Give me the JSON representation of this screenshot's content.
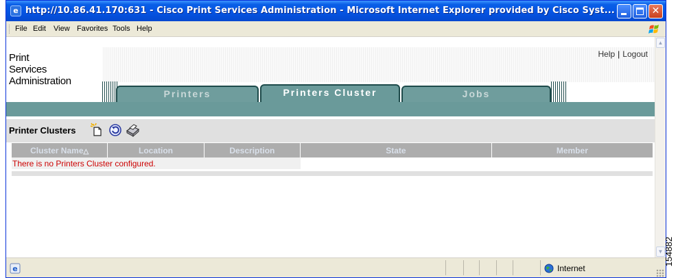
{
  "window": {
    "title": "http://10.86.41.170:631 - Cisco Print Services Administration - Microsoft Internet Explorer provided by Cisco Syst...",
    "minimize_label": "",
    "close_glyph": "✕"
  },
  "menu": [
    "File",
    "Edit",
    "View",
    "Favorites",
    "Tools",
    "Help"
  ],
  "app": {
    "title_lines": [
      "Print",
      "Services",
      "Administration"
    ],
    "links": {
      "help": "Help",
      "separator": "|",
      "logout": "Logout"
    },
    "tabs": [
      {
        "label": "Printers",
        "active": false
      },
      {
        "label": "Printers Cluster",
        "active": true
      },
      {
        "label": "Jobs",
        "active": false
      }
    ]
  },
  "section": {
    "title": "Printer Clusters",
    "icons": [
      "new-cluster-icon",
      "refresh-icon",
      "printer-icon"
    ]
  },
  "table": {
    "columns": [
      "Cluster Name",
      "Location",
      "Description",
      "State",
      "Member"
    ],
    "sort_indicator": "△",
    "empty_message": "There is no Printers Cluster configured."
  },
  "statusbar": {
    "zone": "Internet"
  },
  "figure_number": "154882",
  "colors": {
    "teal": "#6a9a9a",
    "error_text": "#cc0000",
    "titlebar_blue": "#0554e3"
  }
}
